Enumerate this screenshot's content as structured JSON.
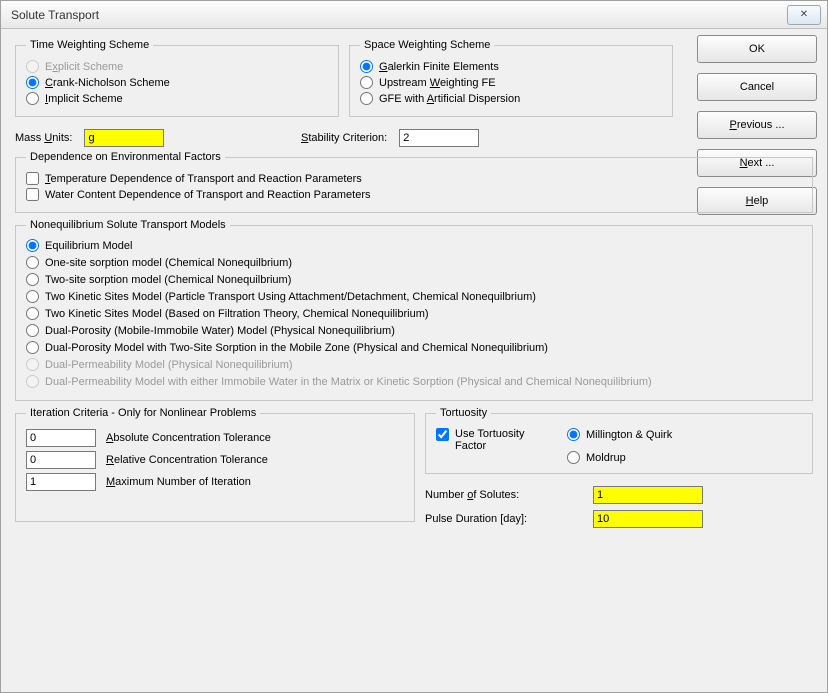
{
  "window": {
    "title": "Solute Transport"
  },
  "buttons": {
    "ok": "OK",
    "cancel": "Cancel",
    "previous": "Previous ...",
    "next": "Next ...",
    "help": "Help"
  },
  "time_weighting": {
    "legend": "Time Weighting Scheme",
    "explicit_pre": "E",
    "explicit_u": "x",
    "explicit_post": "plicit Scheme",
    "crank_pre": "",
    "crank_u": "C",
    "crank_post": "rank-Nicholson Scheme",
    "implicit_pre": "",
    "implicit_u": "I",
    "implicit_post": "mplicit Scheme"
  },
  "space_weighting": {
    "legend": "Space Weighting Scheme",
    "galerkin_pre": "",
    "galerkin_u": "G",
    "galerkin_post": "alerkin Finite Elements",
    "upstream_pre": "Upstream ",
    "upstream_u": "W",
    "upstream_post": "eighting FE",
    "gfe_pre": "GFE with ",
    "gfe_u": "A",
    "gfe_post": "rtificial Dispersion"
  },
  "mass_units": {
    "label_pre": "Mass ",
    "label_u": "U",
    "label_post": "nits:",
    "value": "g"
  },
  "stability": {
    "label_pre": "",
    "label_u": "S",
    "label_post": "tability Criterion:",
    "value": "2"
  },
  "env": {
    "legend": "Dependence on Environmental Factors",
    "temp_pre": "",
    "temp_u": "T",
    "temp_post": "emperature Dependence of Transport and Reaction Parameters",
    "water": "Water Content Dependence of Transport and Reaction Parameters"
  },
  "noneq": {
    "legend": "Nonequilibrium Solute Transport Models",
    "opts": [
      "Equilibrium Model",
      "One-site sorption model (Chemical Nonequilbrium)",
      "Two-site sorption model (Chemical Nonequilbrium)",
      "Two Kinetic Sites Model (Particle Transport Using Attachment/Detachment, Chemical Nonequilbrium)",
      "Two Kinetic Sites Model (Based on Filtration Theory, Chemical Nonequilibrium)",
      "Dual-Porosity (Mobile-Immobile Water) Model (Physical Nonequilibrium)",
      "Dual-Porosity Model with Two-Site Sorption in the Mobile Zone (Physical and Chemical Nonequilibrium)",
      "Dual-Permeability Model (Physical Nonequilibrium)",
      "Dual-Permeability Model with either Immobile Water in the Matrix or Kinetic Sorption (Physical and Chemical Nonequilibrium)"
    ]
  },
  "iter": {
    "legend": "Iteration Criteria - Only for Nonlinear Problems",
    "abs_value": "0",
    "abs_pre": "",
    "abs_u": "A",
    "abs_post": "bsolute Concentration Tolerance",
    "rel_value": "0",
    "rel_pre": "",
    "rel_u": "R",
    "rel_post": "elative Concentration Tolerance",
    "max_value": "1",
    "max_pre": "",
    "max_u": "M",
    "max_post": "aximum Number of Iteration"
  },
  "tortuosity": {
    "legend": "Tortuosity",
    "use_label": "Use Tortuosity Factor",
    "millington": "Millington & Quirk",
    "moldrup": "Moldrup"
  },
  "solutes": {
    "label_pre": "Number ",
    "label_u": "o",
    "label_post": "f Solutes:",
    "value": "1"
  },
  "pulse": {
    "label": "Pulse Duration [day]:",
    "value": "10"
  }
}
